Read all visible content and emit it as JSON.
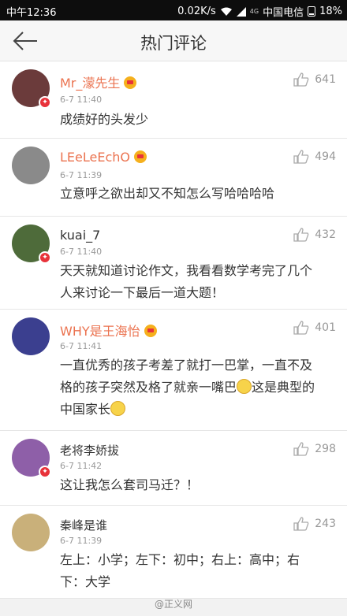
{
  "status_bar": {
    "time": "中午12:36",
    "speed": "0.02K/s",
    "sim_label": "4G",
    "carrier": "中国电信",
    "battery": "18%"
  },
  "nav": {
    "title": "热门评论"
  },
  "comments": [
    {
      "name": "Mr_濛先生",
      "vip": true,
      "verified": true,
      "time": "6-7 11:40",
      "text": "成绩好的头发少",
      "likes": "641",
      "avatar_color": "#6b3b3b"
    },
    {
      "name": "LEeLeEchO",
      "vip": true,
      "verified": false,
      "time": "6-7 11:39",
      "text": "立意呼之欲出却又不知怎么写哈哈哈哈",
      "likes": "494",
      "avatar_color": "#8a8a8a"
    },
    {
      "name": "kuai_7",
      "vip": false,
      "verified": true,
      "time": "6-7 11:40",
      "text": "天天就知道讨论作文，我看看数学考完了几个人来讨论一下最后一道大题！",
      "likes": "432",
      "avatar_color": "#4e6b3a"
    },
    {
      "name": "WHY是王海怡",
      "vip": true,
      "verified": false,
      "time": "6-7 11:41",
      "text": "一直优秀的孩子考差了就打一巴掌，一直不及格的孩子突然及格了就亲一嘴巴",
      "text2": "这是典型的中国家长",
      "likes": "401",
      "avatar_color": "#3b3f8f"
    },
    {
      "name": "老将李娇拔",
      "vip": false,
      "verified": true,
      "time": "6-7 11:42",
      "text": "这让我怎么套司马迁？！",
      "likes": "298",
      "avatar_color": "#8e5fa8"
    },
    {
      "name": "秦峰是谁",
      "vip": false,
      "verified": false,
      "time": "6-7 11:39",
      "text": "左上：小学；左下：初中；右上：高中；右下：大学",
      "likes": "243",
      "avatar_color": "#c9b07a"
    }
  ],
  "watermark": "@正义网"
}
